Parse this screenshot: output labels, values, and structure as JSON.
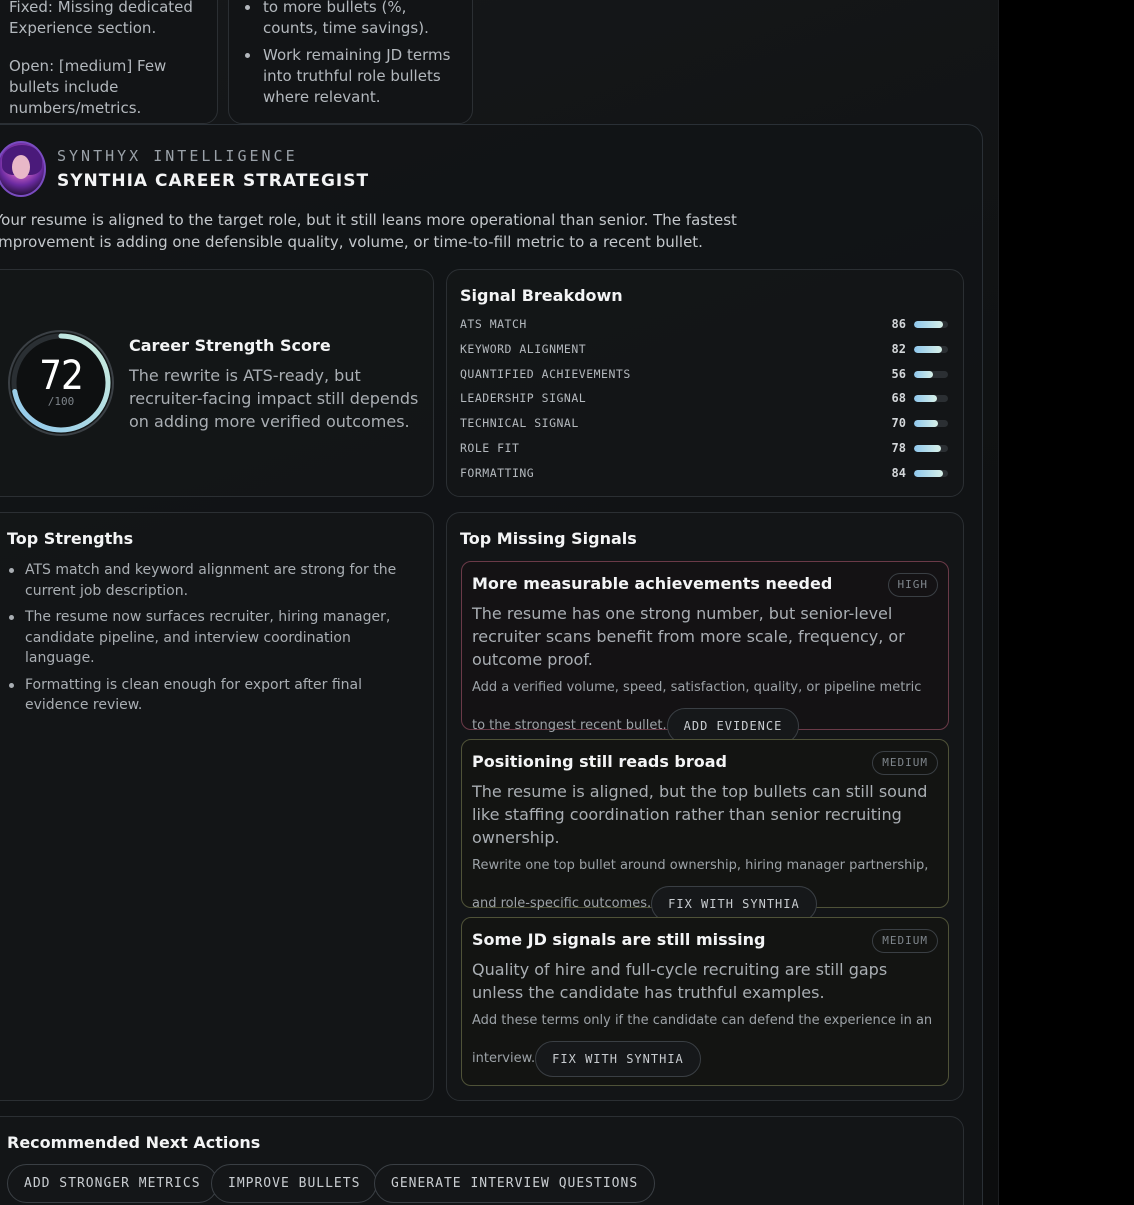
{
  "top_left_card": {
    "fixed_line": "Fixed: Missing dedicated Experience section.",
    "open_line": "Open: [medium] Few bullets include numbers/metrics."
  },
  "top_right_card": {
    "items": [
      "to more bullets (%, counts, time savings).",
      "Work remaining JD terms into truthful role bullets where relevant."
    ]
  },
  "header": {
    "eyebrow": "SYNTHYX INTELLIGENCE",
    "title": "SYNTHIA CAREER STRATEGIST",
    "summary": "Your resume is aligned to the target role, but it still leans more operational than senior. The fastest improvement is adding one defensible quality, volume, or time-to-fill metric to a recent bullet."
  },
  "score": {
    "value": "72",
    "max_label": "/100",
    "fraction": 0.72,
    "title": "Career Strength Score",
    "description": "The rewrite is ATS-ready, but recruiter-facing impact still depends on adding more verified outcomes."
  },
  "signal_breakdown": {
    "title": "Signal Breakdown",
    "rows": [
      {
        "label": "ATS MATCH",
        "value": "86",
        "pct": 86
      },
      {
        "label": "KEYWORD ALIGNMENT",
        "value": "82",
        "pct": 82
      },
      {
        "label": "QUANTIFIED ACHIEVEMENTS",
        "value": "56",
        "pct": 56
      },
      {
        "label": "LEADERSHIP SIGNAL",
        "value": "68",
        "pct": 68
      },
      {
        "label": "TECHNICAL SIGNAL",
        "value": "70",
        "pct": 70
      },
      {
        "label": "ROLE FIT",
        "value": "78",
        "pct": 78
      },
      {
        "label": "FORMATTING",
        "value": "84",
        "pct": 84
      }
    ]
  },
  "strengths": {
    "title": "Top Strengths",
    "items": [
      "ATS match and keyword alignment are strong for the current job description.",
      "The resume now surfaces recruiter, hiring manager, candidate pipeline, and interview coordination language.",
      "Formatting is clean enough for export after final evidence review."
    ]
  },
  "missing": {
    "title": "Top Missing Signals",
    "items": [
      {
        "title": "More measurable achievements needed",
        "severity": "HIGH",
        "body": "The resume has one strong number, but senior-level recruiter scans benefit from more scale, frequency, or outcome proof.",
        "recommendation": "Add a verified volume, speed, satisfaction, quality, or pipeline metric to the strongest recent bullet.",
        "action": "ADD EVIDENCE",
        "border_color": "#6b3a48"
      },
      {
        "title": "Positioning still reads broad",
        "severity": "MEDIUM",
        "body": "The resume is aligned, but the top bullets can still sound like staffing coordination rather than senior recruiting ownership.",
        "recommendation": "Rewrite one top bullet around ownership, hiring manager partnership, and role-specific outcomes.",
        "action": "FIX WITH SYNTHIA",
        "border_color": "#4f5238"
      },
      {
        "title": "Some JD signals are still missing",
        "severity": "MEDIUM",
        "body": "Quality of hire and full-cycle recruiting are still gaps unless the candidate has truthful examples.",
        "recommendation": "Add these terms only if the candidate can defend the experience in an interview.",
        "action": "FIX WITH SYNTHIA",
        "border_color": "#4f5238"
      }
    ]
  },
  "next_actions": {
    "title": "Recommended Next Actions",
    "buttons": [
      "ADD STRONGER METRICS",
      "IMPROVE BULLETS",
      "GENERATE INTERVIEW QUESTIONS"
    ]
  }
}
